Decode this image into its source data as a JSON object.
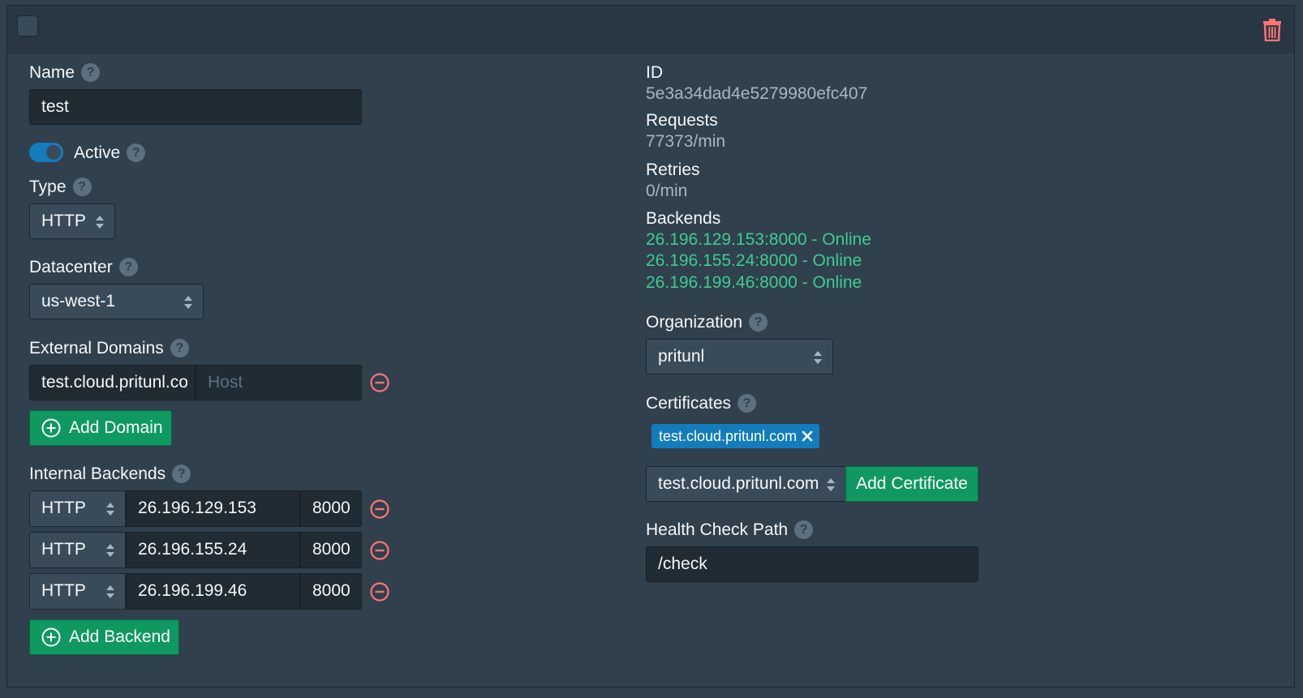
{
  "header": {
    "select_checkbox": "",
    "delete_icon": "trash-icon"
  },
  "left": {
    "name_label": "Name",
    "name_value": "test",
    "active_label": "Active",
    "active_on": true,
    "type_label": "Type",
    "type_value": "HTTP",
    "datacenter_label": "Datacenter",
    "datacenter_value": "us-west-1",
    "external_domains_label": "External Domains",
    "domains": [
      {
        "domain": "test.cloud.pritunl.co",
        "host_placeholder": "Host"
      }
    ],
    "add_domain_label": "Add Domain",
    "internal_backends_label": "Internal Backends",
    "backends": [
      {
        "protocol": "HTTP",
        "ip": "26.196.129.153",
        "port": "8000"
      },
      {
        "protocol": "HTTP",
        "ip": "26.196.155.24",
        "port": "8000"
      },
      {
        "protocol": "HTTP",
        "ip": "26.196.199.46",
        "port": "8000"
      }
    ],
    "add_backend_label": "Add Backend"
  },
  "right": {
    "id_label": "ID",
    "id_value": "5e3a34dad4e5279980efc407",
    "requests_label": "Requests",
    "requests_value": "77373/min",
    "retries_label": "Retries",
    "retries_value": "0/min",
    "backends_label": "Backends",
    "backend_status": [
      "26.196.129.153:8000 - Online",
      "26.196.155.24:8000 - Online",
      "26.196.199.46:8000 - Online"
    ],
    "organization_label": "Organization",
    "organization_value": "pritunl",
    "certificates_label": "Certificates",
    "certificate_tags": [
      "test.cloud.pritunl.com"
    ],
    "certificate_select_value": "test.cloud.pritunl.com",
    "add_certificate_label": "Add Certificate",
    "health_check_label": "Health Check Path",
    "health_check_value": "/check"
  },
  "colors": {
    "background": "#30404d",
    "header": "#293742",
    "input": "#202b33",
    "select": "#394b59",
    "green": "#0f9960",
    "online": "#3dcc91",
    "blue": "#137cbd",
    "danger": "#ff7373"
  },
  "help_glyph": "?"
}
